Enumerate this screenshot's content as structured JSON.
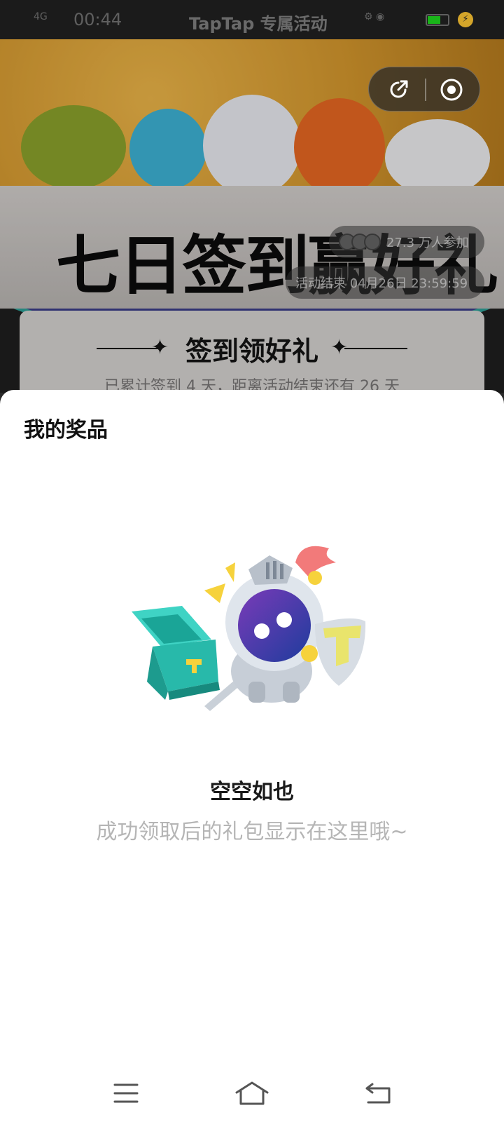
{
  "status_bar": {
    "signal": "4G",
    "time": "00:44",
    "title": "TapTap 专属活动",
    "battery_level": "5",
    "battery_color": "#19b419"
  },
  "banner": {
    "title": "七日签到赢好礼",
    "participants": "27.3 万人参加",
    "end_time": "活动结束 04月26日 23:59:59"
  },
  "capsule": {
    "share_icon": "share-icon",
    "close_icon": "target-close-icon"
  },
  "checkin_card": {
    "title": "签到领好礼",
    "subtitle": "已累计签到 4 天，距离活动结束还有 26 天"
  },
  "sheet": {
    "title": "我的奖品",
    "empty_title": "空空如也",
    "empty_subtitle": "成功领取后的礼包显示在这里哦~",
    "illustration": "knight-with-chest-illustration"
  },
  "nav_bar": {
    "menu_icon": "menu-icon",
    "home_icon": "home-icon",
    "back_icon": "back-icon"
  },
  "colors": {
    "accent_gold": "#f1b94a",
    "sheet_bg": "#ffffff",
    "muted_text": "#b5b5b5"
  }
}
